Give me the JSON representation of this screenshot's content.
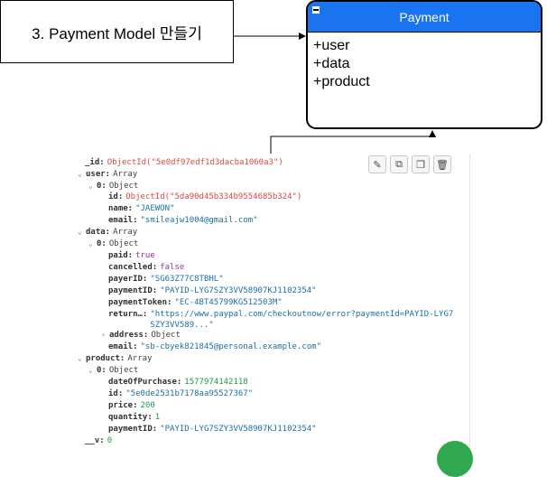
{
  "step_box": {
    "label": "3. Payment Model 만들기"
  },
  "class_box": {
    "title": "Payment",
    "fields": [
      "+user",
      "+data",
      "+product"
    ]
  },
  "json_viewer": {
    "toolbar": {
      "icons": [
        "edit-icon",
        "copy-icon",
        "clone-icon",
        "delete-icon"
      ]
    },
    "rows": [
      {
        "key": "_id:",
        "val": "ObjectId(\"5e0df97edf1d3dacba1060a3\")",
        "cls": "oid"
      },
      {
        "key": "user:",
        "val": "Array",
        "cls": "t",
        "chev": "⌄"
      },
      {
        "key": "0:",
        "val": "Object",
        "cls": "t",
        "chev": "⌄"
      },
      {
        "key": "id:",
        "val": "ObjectId(\"5da90d45b334b9554685b324\")",
        "cls": "oid"
      },
      {
        "key": "name:",
        "val": "\"JAEWON\"",
        "cls": "s"
      },
      {
        "key": "email:",
        "val": "\"smileajw1004@gmail.com\"",
        "cls": "s"
      },
      {
        "key": "data:",
        "val": "Array",
        "cls": "t",
        "chev": "⌄"
      },
      {
        "key": "0:",
        "val": "Object",
        "cls": "t",
        "chev": "⌄"
      },
      {
        "key": "paid:",
        "val": "true",
        "cls": "bool"
      },
      {
        "key": "cancelled:",
        "val": "false",
        "cls": "bool"
      },
      {
        "key": "payerID:",
        "val": "\"SG63Z77C8TBHL\"",
        "cls": "s"
      },
      {
        "key": "paymentID:",
        "val": "\"PAYID-LYG7SZY3VV58907KJ1102354\"",
        "cls": "s"
      },
      {
        "key": "paymentToken:",
        "val": "\"EC-4BT45799KG512503M\"",
        "cls": "s"
      },
      {
        "key": "return…:",
        "val": "\"https://www.paypal.com/checkoutnow/error?paymentId=PAYID-LYG7",
        "val2": "SZY3VV589...\"",
        "cls": "s"
      },
      {
        "key": "address:",
        "val": "Object",
        "cls": "t",
        "chev": "›"
      },
      {
        "key": "email:",
        "val": "\"sb-cbyek821845@personal.example.com\"",
        "cls": "s"
      },
      {
        "key": "product:",
        "val": "Array",
        "cls": "t",
        "chev": "⌄"
      },
      {
        "key": "0:",
        "val": "Object",
        "cls": "t",
        "chev": "⌄"
      },
      {
        "key": "dateOfPurchase:",
        "val": "1577974142118",
        "cls": "num"
      },
      {
        "key": "id:",
        "val": "\"5e0de2531b7178aa95527367\"",
        "cls": "s"
      },
      {
        "key": "price:",
        "val": "200",
        "cls": "num"
      },
      {
        "key": "quantity:",
        "val": "1",
        "cls": "num"
      },
      {
        "key": "paymentID:",
        "val": "\"PAYID-LYG7SZY3VV58907KJ1102354\"",
        "cls": "s"
      },
      {
        "key": "__v:",
        "val": "0",
        "cls": "num"
      }
    ]
  },
  "colors": {
    "header_blue": "#1a74f0",
    "objectid": "#e0463d",
    "string": "#1b6ea6",
    "number": "#199b4a",
    "boolean": "#9b2fae"
  }
}
